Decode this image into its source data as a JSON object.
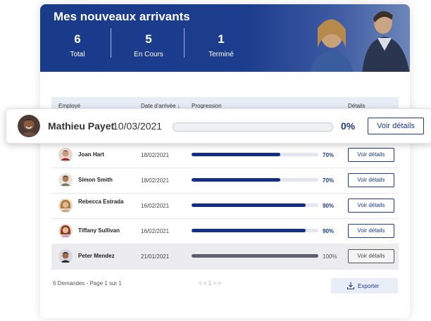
{
  "header": {
    "title": "Mes nouveaux arrivants",
    "stats": [
      {
        "value": "6",
        "label": "Total"
      },
      {
        "value": "5",
        "label": "En Cours"
      },
      {
        "value": "1",
        "label": "Terminé"
      }
    ]
  },
  "table": {
    "columns": {
      "employee": "Employé",
      "date": "Date d'arrivée",
      "sort_icon": "arrow-down-icon",
      "progress": "Progression",
      "details": "Détails"
    },
    "rows": [
      {
        "name": "Joan Hart",
        "date": "18/02/2021",
        "progress": 0.7,
        "percent": "70%",
        "action": "Voir détails"
      },
      {
        "name": "Simon Smith",
        "date": "18/02/2021",
        "progress": 0.7,
        "percent": "70%",
        "action": "Voir détails"
      },
      {
        "name": "Rebecca Estrada",
        "date": "16/02/2021",
        "progress": 0.9,
        "percent": "90%",
        "action": "Voir détails"
      },
      {
        "name": "Tiffany Sullivan",
        "date": "16/02/2021",
        "progress": 0.9,
        "percent": "90%",
        "action": "Voir détails"
      },
      {
        "name": "Peter Mendez",
        "date": "21/01/2021",
        "progress": 1.0,
        "percent": "100%",
        "action": "Voir détails"
      }
    ]
  },
  "highlight": {
    "name": "Mathieu Payet",
    "date": "10/03/2021",
    "progress": 0.0,
    "percent": "0%",
    "action": "Voir détails"
  },
  "footer": {
    "summary": "6 Demandes - Page 1 sur 1",
    "pager": "< <    1    > >",
    "export_label": "Exporter",
    "export_icon": "download-icon"
  },
  "colors": {
    "brand": "#1a3a8a",
    "bar_fill": "#142e85",
    "complete_fill": "#5a5f6c"
  }
}
